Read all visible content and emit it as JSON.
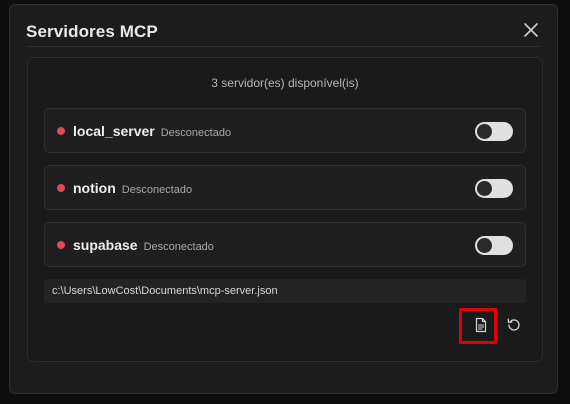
{
  "dialog": {
    "title": "Servidores MCP",
    "close_icon": "close-icon"
  },
  "panel": {
    "summary": "3 servidor(es) disponível(is)",
    "servers": [
      {
        "name": "local_server",
        "status": "Desconectado",
        "enabled": false,
        "status_color": "#e5484d"
      },
      {
        "name": "notion",
        "status": "Desconectado",
        "enabled": false,
        "status_color": "#e5484d"
      },
      {
        "name": "supabase",
        "status": "Desconectado",
        "enabled": false,
        "status_color": "#e5484d"
      }
    ],
    "config_path": "c:\\Users\\LowCost\\Documents\\mcp-server.json",
    "actions": {
      "open_file_icon": "file-text-icon",
      "reload_icon": "refresh-icon"
    }
  },
  "colors": {
    "background": "#1c1c1c",
    "status_disconnected": "#e5484d",
    "highlight": "#e0000a"
  }
}
